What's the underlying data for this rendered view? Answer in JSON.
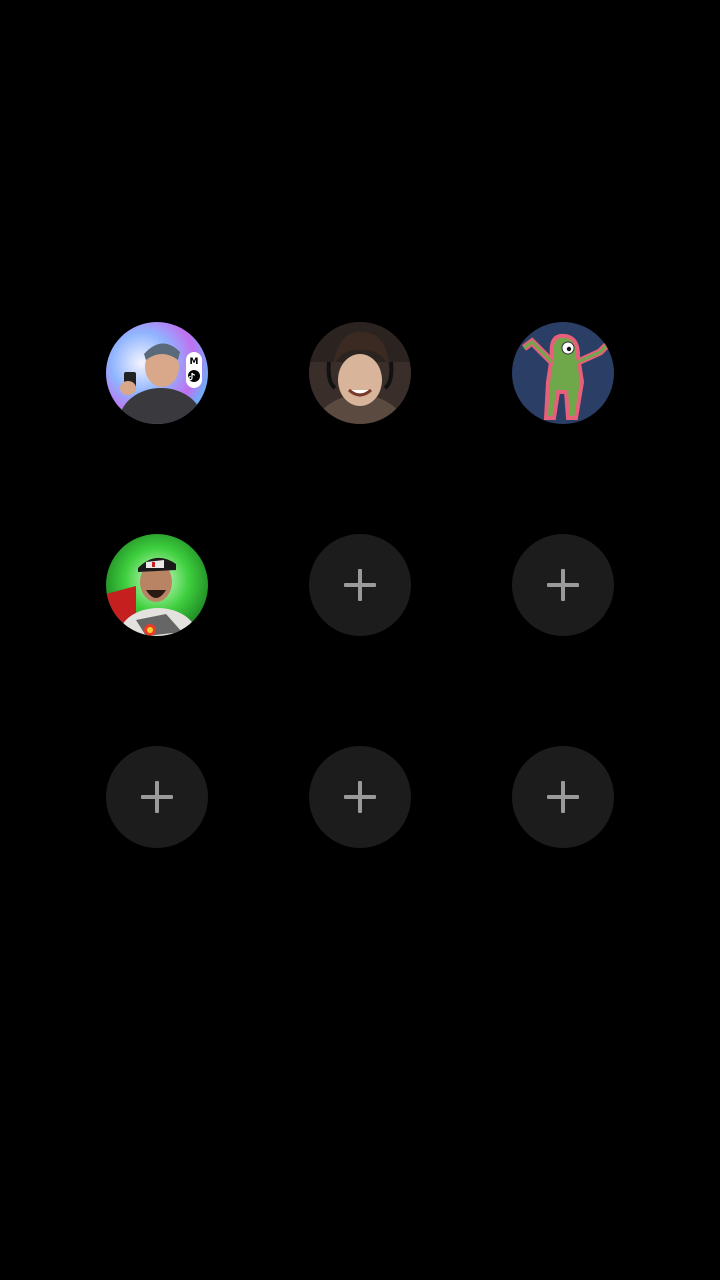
{
  "contacts": [
    {
      "name": "avatar-slot-1",
      "badge": "M"
    },
    {
      "name": "avatar-slot-2"
    },
    {
      "name": "avatar-slot-3"
    },
    {
      "name": "avatar-slot-4"
    }
  ],
  "empty_slots": 5,
  "colors": {
    "background": "#000000",
    "empty_slot": "#1c1c1c",
    "plus_icon": "#9a9a9a"
  },
  "icons": [
    "add-contact-icon",
    "tiktok-icon"
  ]
}
